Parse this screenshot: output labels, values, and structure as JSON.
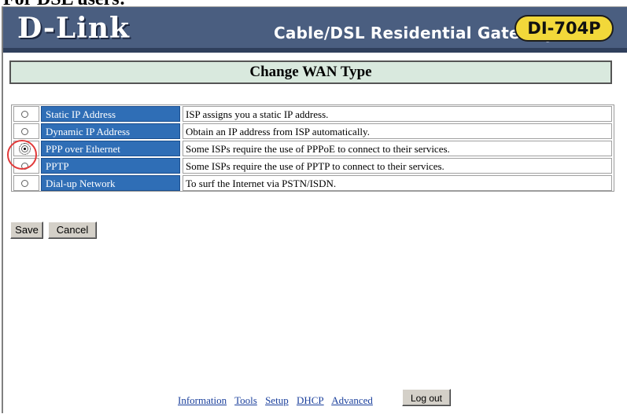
{
  "caption": "For DSL users:",
  "header": {
    "brand": "D-Link",
    "product_name": "Cable/DSL Residential Gateway",
    "model_badge": "DI-704P"
  },
  "page_title": "Change WAN Type",
  "wan_types": [
    {
      "label": "Static IP Address",
      "description": "ISP assigns you a static IP address.",
      "selected": false
    },
    {
      "label": "Dynamic IP Address",
      "description": "Obtain an IP address from ISP automatically.",
      "selected": false
    },
    {
      "label": "PPP over Ethernet",
      "description": "Some ISPs require the use of PPPoE to connect to their services.",
      "selected": true
    },
    {
      "label": "PPTP",
      "description": "Some ISPs require the use of PPTP to connect to their services.",
      "selected": false
    },
    {
      "label": "Dial-up Network",
      "description": "To surf the Internet via PSTN/ISDN.",
      "selected": false
    }
  ],
  "buttons": {
    "save": "Save",
    "cancel": "Cancel",
    "logout": "Log out"
  },
  "nav_links": [
    "Information",
    "Tools",
    "Setup",
    "DHCP",
    "Advanced"
  ],
  "colors": {
    "header_bg": "#4a5e80",
    "badge_bg": "#f2d83a",
    "title_bar_bg": "#d9e9de",
    "label_cell_bg": "#2f6eb6",
    "annotation": "#e23a3a",
    "link": "#1a3f9c"
  }
}
